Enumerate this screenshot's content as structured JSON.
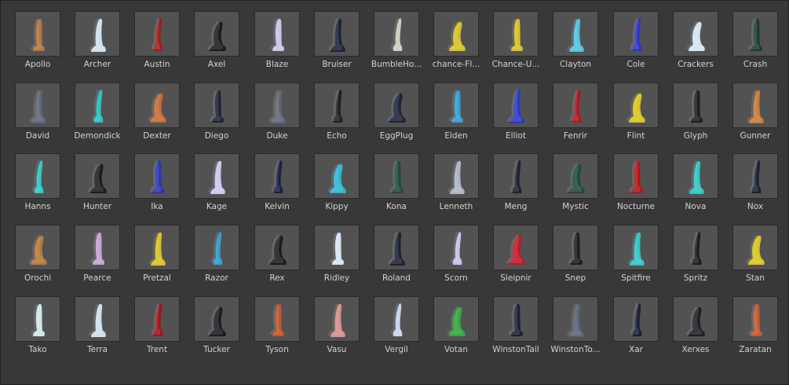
{
  "assets": [
    {
      "label": "Apollo",
      "color": "#b3753a"
    },
    {
      "label": "Archer",
      "color": "#cfe0ef"
    },
    {
      "label": "Austin",
      "color": "#a61b1b"
    },
    {
      "label": "Axel",
      "color": "#1c1c1f"
    },
    {
      "label": "Blaze",
      "color": "#c9c3ea"
    },
    {
      "label": "Bruiser",
      "color": "#1c2238"
    },
    {
      "label": "BumbleHo...",
      "color": "#c6d0bc"
    },
    {
      "label": "chance-Fl...",
      "color": "#d8c021"
    },
    {
      "label": "Chance-U...",
      "color": "#d8c021"
    },
    {
      "label": "Clayton",
      "color": "#53c2dc"
    },
    {
      "label": "Cole",
      "color": "#2e34c8"
    },
    {
      "label": "Crackers",
      "color": "#d3e4f2"
    },
    {
      "label": "Crash",
      "color": "#1d3c30"
    },
    {
      "label": "David",
      "color": "#5e6478"
    },
    {
      "label": "Demondick",
      "color": "#25c3c6"
    },
    {
      "label": "Dexter",
      "color": "#c66a30"
    },
    {
      "label": "Diego",
      "color": "#1c2335"
    },
    {
      "label": "Duke",
      "color": "#616677"
    },
    {
      "label": "Echo",
      "color": "#202022"
    },
    {
      "label": "EggPlug",
      "color": "#1c2238"
    },
    {
      "label": "Elden",
      "color": "#2f9fd6"
    },
    {
      "label": "Elliot",
      "color": "#2a39c4"
    },
    {
      "label": "Fenrir",
      "color": "#b2161f"
    },
    {
      "label": "Flint",
      "color": "#d9c41f"
    },
    {
      "label": "Glyph",
      "color": "#1e1e22"
    },
    {
      "label": "Gunner",
      "color": "#c77c3a"
    },
    {
      "label": "Hanns",
      "color": "#2ec9c6"
    },
    {
      "label": "Hunter",
      "color": "#1c1c20"
    },
    {
      "label": "Ika",
      "color": "#2a35b8"
    },
    {
      "label": "Kage",
      "color": "#cfc7ee"
    },
    {
      "label": "Kelvin",
      "color": "#1b2046"
    },
    {
      "label": "Kippy",
      "color": "#2bb7d2"
    },
    {
      "label": "Kona",
      "color": "#1f4b3f"
    },
    {
      "label": "Lenneth",
      "color": "#aab4c4"
    },
    {
      "label": "Meng",
      "color": "#1c2233"
    },
    {
      "label": "Mystic",
      "color": "#1e4b3a"
    },
    {
      "label": "Nocturne",
      "color": "#b3161c"
    },
    {
      "label": "Nova",
      "color": "#2ec6c2"
    },
    {
      "label": "Nox",
      "color": "#1b2135"
    },
    {
      "label": "Orochi",
      "color": "#b9783a"
    },
    {
      "label": "Pearce",
      "color": "#c3a2d8"
    },
    {
      "label": "Pretzal",
      "color": "#d8c21f"
    },
    {
      "label": "Razor",
      "color": "#2f9ed3"
    },
    {
      "label": "Rex",
      "color": "#1c1c20"
    },
    {
      "label": "Ridley",
      "color": "#d4e4f2"
    },
    {
      "label": "Roland",
      "color": "#1c2134"
    },
    {
      "label": "Scorn",
      "color": "#c4c4ea"
    },
    {
      "label": "Sleipnir",
      "color": "#c21726"
    },
    {
      "label": "Snep",
      "color": "#1d1d20"
    },
    {
      "label": "Spitfire",
      "color": "#2fc5c8"
    },
    {
      "label": "Spritz",
      "color": "#1e1e22"
    },
    {
      "label": "Stan",
      "color": "#d8c41f"
    },
    {
      "label": "Tako",
      "color": "#cfe6e6"
    },
    {
      "label": "Terra",
      "color": "#cde0ef"
    },
    {
      "label": "Trent",
      "color": "#a5121b"
    },
    {
      "label": "Tucker",
      "color": "#1c1c20"
    },
    {
      "label": "Tyson",
      "color": "#c4552a"
    },
    {
      "label": "Vasu",
      "color": "#d88f8a"
    },
    {
      "label": "Vergil",
      "color": "#c6d4f0"
    },
    {
      "label": "Votan",
      "color": "#2fa83a"
    },
    {
      "label": "WinstonTail",
      "color": "#1c2236"
    },
    {
      "label": "WinstonTo...",
      "color": "#5c6278"
    },
    {
      "label": "Xar",
      "color": "#1b2036"
    },
    {
      "label": "Xerxes",
      "color": "#1d1f24"
    },
    {
      "label": "Zaratan",
      "color": "#c45a2e"
    }
  ]
}
